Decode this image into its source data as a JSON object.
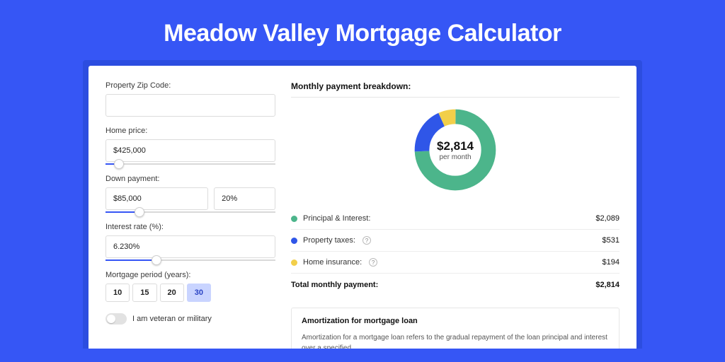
{
  "title": "Meadow Valley Mortgage Calculator",
  "form": {
    "zip_label": "Property Zip Code:",
    "zip_value": "",
    "home_price_label": "Home price:",
    "home_price_value": "$425,000",
    "home_price_pct": 8,
    "down_payment_label": "Down payment:",
    "down_payment_value": "$85,000",
    "down_payment_pct_value": "20%",
    "down_payment_slider_pct": 20,
    "interest_label": "Interest rate (%):",
    "interest_value": "6.230%",
    "interest_slider_pct": 30,
    "period_label": "Mortgage period (years):",
    "periods": [
      {
        "label": "10",
        "selected": false
      },
      {
        "label": "15",
        "selected": false
      },
      {
        "label": "20",
        "selected": false
      },
      {
        "label": "30",
        "selected": true
      }
    ],
    "veteran_label": "I am veteran or military"
  },
  "breakdown": {
    "title": "Monthly payment breakdown:",
    "total": "$2,814",
    "total_sub": "per month",
    "items": [
      {
        "label": "Principal & Interest:",
        "value": "$2,089",
        "color": "#4cb58b",
        "has_info": false
      },
      {
        "label": "Property taxes:",
        "value": "$531",
        "color": "#2f56e8",
        "has_info": true
      },
      {
        "label": "Home insurance:",
        "value": "$194",
        "color": "#f2cf4a",
        "has_info": true
      }
    ],
    "total_row_label": "Total monthly payment:",
    "total_row_value": "$2,814"
  },
  "chart_data": {
    "type": "pie",
    "title": "Monthly payment breakdown",
    "series": [
      {
        "name": "Principal & Interest",
        "value": 2089,
        "color": "#4cb58b"
      },
      {
        "name": "Property taxes",
        "value": 531,
        "color": "#2f56e8"
      },
      {
        "name": "Home insurance",
        "value": 194,
        "color": "#f2cf4a"
      }
    ],
    "total": 2814
  },
  "amort": {
    "title": "Amortization for mortgage loan",
    "text": "Amortization for a mortgage loan refers to the gradual repayment of the loan principal and interest over a specified"
  }
}
